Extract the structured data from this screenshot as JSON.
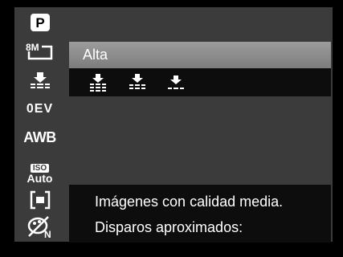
{
  "sidebar": {
    "items": [
      {
        "icon": "program-mode-icon",
        "label": "P"
      },
      {
        "icon": "image-size-8m-icon",
        "label": "8M"
      },
      {
        "icon": "quality-normal-icon",
        "label": ""
      },
      {
        "icon": "exposure-icon",
        "label": "0EV"
      },
      {
        "icon": "white-balance-icon",
        "label": "AWB"
      },
      {
        "icon": "iso-auto-icon",
        "label_top": "ISO",
        "label_bottom": "Auto"
      },
      {
        "icon": "metering-center-icon",
        "label": ""
      },
      {
        "icon": "color-normal-icon",
        "label": "N"
      }
    ]
  },
  "menu": {
    "selected_label": "Alta",
    "options": [
      {
        "icon": "quality-fine-icon",
        "selected": true
      },
      {
        "icon": "quality-normal-icon",
        "selected": false
      },
      {
        "icon": "quality-economy-icon",
        "selected": false
      }
    ]
  },
  "info": {
    "line1": "Imágenes con calidad media.",
    "line2": "Disparos aproximados:"
  },
  "colors": {
    "panel": "#3b3b3b",
    "highlight": "#8c8c8c",
    "row_bg": "#0d0d0d"
  }
}
